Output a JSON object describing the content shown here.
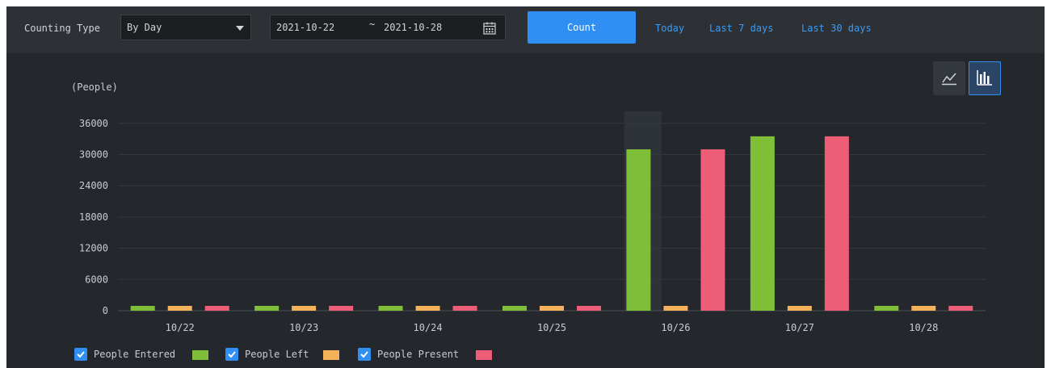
{
  "toolbar": {
    "counting_type_label": "Counting Type",
    "counting_type_value": "By Day",
    "start_date": "2021-10-22",
    "date_separator": "~",
    "end_date": "2021-10-28",
    "count_label": "Count",
    "quick_ranges": [
      "Today",
      "Last 7 days",
      "Last 30 days"
    ]
  },
  "view_toggle": {
    "active": "bar",
    "options": [
      "line-chart-icon",
      "bar-chart-icon"
    ]
  },
  "colors": {
    "entered": "#7fbf37",
    "left": "#f5b25a",
    "present": "#ee5d76",
    "accent": "#2f8ff2"
  },
  "chart_data": {
    "type": "bar",
    "ylabel": "(People)",
    "categories": [
      "10/22",
      "10/23",
      "10/24",
      "10/25",
      "10/26",
      "10/27",
      "10/28"
    ],
    "yticks": [
      0,
      6000,
      12000,
      18000,
      24000,
      30000,
      36000
    ],
    "ylim": [
      0,
      40000
    ],
    "grid": true,
    "highlighted_category": "10/26",
    "series": [
      {
        "name": "People Entered",
        "color": "#7fbf37",
        "values": [
          0,
          0,
          0,
          0,
          31000,
          33500,
          0
        ]
      },
      {
        "name": "People Left",
        "color": "#f5b25a",
        "values": [
          0,
          0,
          0,
          0,
          0,
          0,
          0
        ]
      },
      {
        "name": "People Present",
        "color": "#ee5d76",
        "values": [
          0,
          0,
          0,
          0,
          31000,
          33500,
          0
        ]
      }
    ],
    "legend_position": "bottom-left"
  }
}
